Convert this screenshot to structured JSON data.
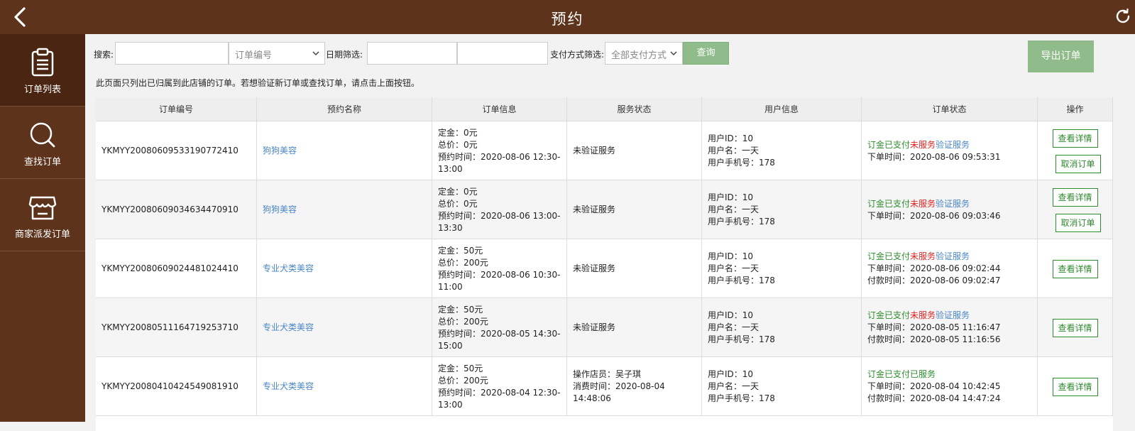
{
  "header": {
    "title": "预约"
  },
  "sidebar": {
    "items": [
      {
        "label": "订单列表",
        "icon": "clipboard-icon",
        "active": true
      },
      {
        "label": "查找订单",
        "icon": "search-icon",
        "active": false
      },
      {
        "label": "商家派发订单",
        "icon": "store-icon",
        "active": false
      }
    ]
  },
  "filters": {
    "search_label": "搜索:",
    "search_value": "",
    "search_type_selected": "订单编号",
    "date_label": "日期筛选:",
    "date_start": "",
    "date_end": "",
    "pay_label": "支付方式筛选:",
    "pay_selected": "全部支付方式",
    "query_button": "查询",
    "export_button": "导出订单"
  },
  "notice": "此页面只列出已归属到此店铺的订单。若想验证新订单或查找订单，请点击上面按钮。",
  "table": {
    "headers": [
      "订单编号",
      "预约名称",
      "订单信息",
      "服务状态",
      "用户信息",
      "订单状态",
      "操作"
    ],
    "rows": [
      {
        "order_no": "YKMYY20080609533190772410",
        "name": "狗狗美容",
        "info": [
          "定金：0元",
          "总价：0元",
          "预约时间：2020-08-06 12:30-",
          "13:00"
        ],
        "service": [
          "未验证服务"
        ],
        "user": [
          "用户ID：10",
          "用户名：一天",
          "用户手机号：178"
        ],
        "status_a": "订金已支付",
        "status_b": "未服务",
        "status_c": "验证服务",
        "times": [
          "下单时间：2020-08-06 09:53:31"
        ],
        "ops": [
          "查看详情",
          "取消订单"
        ]
      },
      {
        "order_no": "YKMYY20080609034634470910",
        "name": "狗狗美容",
        "info": [
          "定金：0元",
          "总价：0元",
          "预约时间：2020-08-06 13:00-",
          "13:30"
        ],
        "service": [
          "未验证服务"
        ],
        "user": [
          "用户ID：10",
          "用户名：一天",
          "用户手机号：178"
        ],
        "status_a": "订金已支付",
        "status_b": "未服务",
        "status_c": "验证服务",
        "times": [
          "下单时间：2020-08-06 09:03:46"
        ],
        "ops": [
          "查看详情",
          "取消订单"
        ]
      },
      {
        "order_no": "YKMYY20080609024481024410",
        "name": "专业犬类美容",
        "info": [
          "定金：50元",
          "总价：200元",
          "预约时间：2020-08-06 10:30-",
          "11:00"
        ],
        "service": [
          "未验证服务"
        ],
        "user": [
          "用户ID：10",
          "用户名：一天",
          "用户手机号：178"
        ],
        "status_a": "订金已支付",
        "status_b": "未服务",
        "status_c": "验证服务",
        "times": [
          "下单时间：2020-08-06 09:02:44",
          "付款时间：2020-08-06 09:02:47"
        ],
        "ops": [
          "查看详情"
        ]
      },
      {
        "order_no": "YKMYY20080511164719253710",
        "name": "专业犬类美容",
        "info": [
          "定金：50元",
          "总价：200元",
          "预约时间：2020-08-05 14:30-",
          "15:00"
        ],
        "service": [
          "未验证服务"
        ],
        "user": [
          "用户ID：10",
          "用户名：一天",
          "用户手机号：178"
        ],
        "status_a": "订金已支付",
        "status_b": "未服务",
        "status_c": "验证服务",
        "times": [
          "下单时间：2020-08-05 11:16:47",
          "付款时间：2020-08-05 11:16:56"
        ],
        "ops": [
          "查看详情"
        ]
      },
      {
        "order_no": "YKMYY20080410424549081910",
        "name": "专业犬类美容",
        "info": [
          "定金：50元",
          "总价：200元",
          "预约时间：2020-08-04 12:30-",
          "13:00"
        ],
        "service": [
          "操作店员：吴子琪",
          "消费时间：2020-08-04",
          "14:48:06"
        ],
        "user": [
          "用户ID：10",
          "用户名：一天",
          "用户手机号：178"
        ],
        "status_a": "订金已支付已服务",
        "status_b": "",
        "status_c": "",
        "times": [
          "下单时间：2020-08-04 10:42:45",
          "付款时间：2020-08-04 14:47:24"
        ],
        "ops": [
          "查看详情"
        ]
      }
    ]
  },
  "colors": {
    "brand": "#5e331b",
    "accent_button": "#8fbc8a",
    "status_green": "#2e8b2e",
    "status_red": "#e02424",
    "link_blue": "#4a86c5"
  }
}
